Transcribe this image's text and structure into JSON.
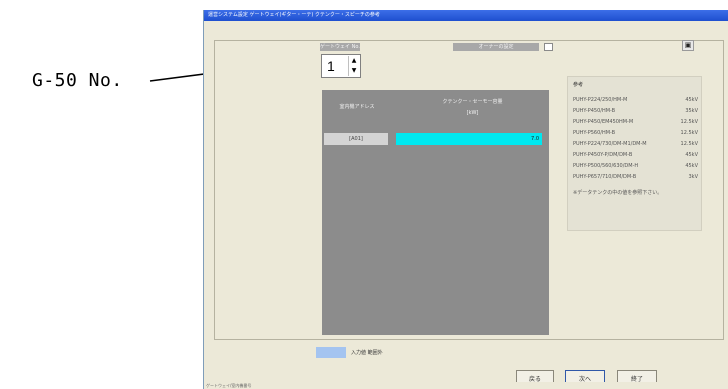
{
  "callout": {
    "label": "G-50 No."
  },
  "window": {
    "title": "運営システム設定 ゲートウェイ(ギター・ーテ) クテンクー・スピーチの参考"
  },
  "g50": {
    "label": "ゲートウェイ No.",
    "value": "1",
    "spin_up": "▲",
    "spin_down": "▼"
  },
  "option": {
    "label": "オーナーの設定"
  },
  "settings_icon": "▣",
  "table": {
    "col_address": "室内機アドレス",
    "col_unit_line1": "クテンクー・セーモー容量",
    "col_unit_line2": "[kW]",
    "rows": [
      {
        "address": "[A01]",
        "value": "7.0"
      }
    ]
  },
  "reference": {
    "title": "参考",
    "items": [
      {
        "name": "PUHY-P224/250/HM-M",
        "value": "45kV"
      },
      {
        "name": "PUHY-P450/HM-B",
        "value": "35kV"
      },
      {
        "name": "PUHY-P450/EM450HM-M",
        "value": "12.5kV"
      },
      {
        "name": "PUHY-P560/HM-B",
        "value": "12.5kV"
      },
      {
        "name": "PUHY-P224/730/DM-M1/DM-M",
        "value": "12.5kV"
      },
      {
        "name": "PUHY-P450Y-P/DM/DM-B",
        "value": "45kV"
      },
      {
        "name": "PUHY-P500/560/630/DM-H",
        "value": "45kV"
      },
      {
        "name": "PUHY-P657/710/DM/DM-B",
        "value": "3kV"
      }
    ],
    "note": "※データテンクの中の値を参照下さい。"
  },
  "legend": {
    "text": "入力値 範囲外"
  },
  "buttons": {
    "back": "戻る",
    "next": "次へ",
    "exit": "終了"
  },
  "status": {
    "text": "ゲートウェイ/室内機番号"
  },
  "colors": {
    "accent": "#00e8f0",
    "legend": "#a4c4f0",
    "title_bar": "#1e4fcf"
  }
}
